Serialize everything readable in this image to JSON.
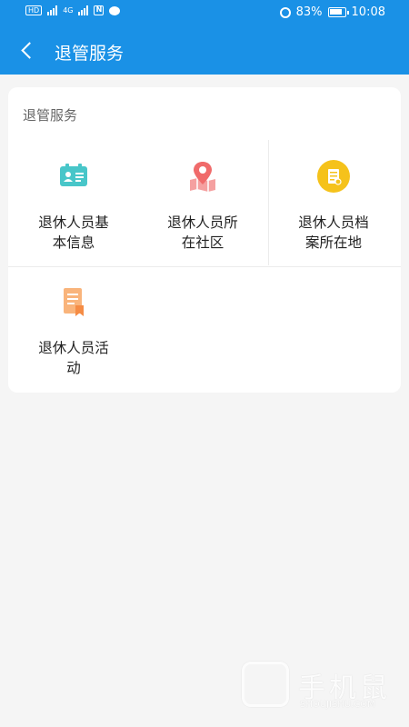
{
  "status": {
    "hd1": "HD",
    "hd2": "HD",
    "net": "4G",
    "battery": "83%",
    "time": "10:08"
  },
  "nav": {
    "title": "退管服务"
  },
  "card": {
    "title": "退管服务",
    "items": [
      {
        "line1": "退休人员基",
        "line2": "本信息",
        "icon": "id-card-icon",
        "color": "#48c6c9"
      },
      {
        "line1": "退休人员所",
        "line2": "在社区",
        "icon": "map-pin-icon",
        "color": "#f06b6b"
      },
      {
        "line1": "退休人员档",
        "line2": "案所在地",
        "icon": "archive-icon",
        "color": "#f5c21b"
      },
      {
        "line1": "退休人员活",
        "line2": "动",
        "icon": "document-icon",
        "color": "#f9b47b"
      }
    ]
  },
  "watermark": {
    "text": "手机鼠",
    "sub": "SHOUJISHU.COM"
  }
}
